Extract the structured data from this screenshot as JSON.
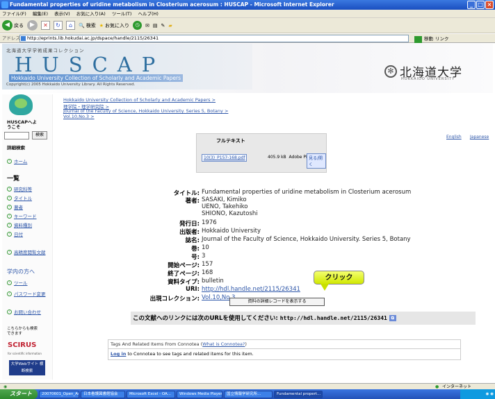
{
  "window": {
    "title": "Fundamental properties of uridine metabolism in Closterium acerosum : HUSCAP - Microsoft Internet Explorer",
    "min": "_",
    "max": "□",
    "close": "×"
  },
  "menu": [
    "ファイル(F)",
    "編集(E)",
    "表示(V)",
    "お気に入り(A)",
    "ツール(T)",
    "ヘルプ(H)"
  ],
  "toolbar": {
    "back": "戻る",
    "search": "検索",
    "favorites": "お気に入り"
  },
  "address": {
    "label": "アドレス(D)",
    "url": "http://eprints.lib.hokudai.ac.jp/dspace/handle/2115/26341",
    "go": "移動",
    "links": "リンク"
  },
  "banner": {
    "coll_jp": "北海道大学学術成果コレクション",
    "logo": "HUSCAP",
    "subtitle": "Hokkaido University Collection of Scholarly and Academic Papers",
    "copyright": "Copyright(c) 2005 Hokkaido University Library. All Rights Reserved.",
    "univ": "北海道大学",
    "univ_en": "HOKKAIDO UNIVERSITY"
  },
  "sidebar": {
    "welcome": "HUSCAPへようこそ",
    "search_btn": "検索",
    "advanced": "詳細検索",
    "home": "ホーム",
    "list_head": "一覧",
    "list": [
      "研究科等",
      "タイトル",
      "著者",
      "キーワード",
      "資料種別",
      "日付"
    ],
    "hot": "高精度閲覧文献",
    "for_you": "学内の方へ",
    "tools": [
      "ツール",
      "パスワード変更"
    ],
    "contact": "お問い合わせ",
    "more_search": "こちらからも検索できます",
    "scirus": "SCIRUS",
    "scirus_sub": "for scientific information",
    "univ_btn": "大学Webサイト 横断検索"
  },
  "breadcrumbs": [
    "Hokkaido University Collection of Scholarly and Academic Papers",
    "理学院・理学研究院",
    "Journal of the Faculty of Science, Hokkaido University. Series 5, Botany",
    "Vol.10,No.3"
  ],
  "crumb_sep": ">",
  "lang": {
    "en": "English",
    "ja": "Japanese"
  },
  "fulltext": {
    "heading": "フルテキスト",
    "file": "10(3)_P157-168.pdf",
    "size": "405.9 kB",
    "format": "Adobe PDF",
    "view": "見る/開く"
  },
  "meta": {
    "title_label": "タイトル:",
    "title": "Fundamental properties of uridine metabolism in Closterium acerosum",
    "authors_label": "著者:",
    "authors": [
      "SASAKI, Kimiko",
      "UENO, Takehiko",
      "SHIONO, Kazutoshi"
    ],
    "date_label": "発行日:",
    "date": "1976",
    "publisher_label": "出版者:",
    "publisher": "Hokkaido University",
    "journal_label": "誌名:",
    "journal": "Journal of the Faculty of Science, Hokkaido University. Series 5, Botany",
    "volume_label": "巻:",
    "volume": "10",
    "issue_label": "号:",
    "issue": "3",
    "spage_label": "開始ページ:",
    "spage": "157",
    "epage_label": "終了ページ:",
    "epage": "168",
    "type_label": "資料タイプ:",
    "type": "bulletin",
    "uri_label": "URI:",
    "uri": "http://hdl.handle.net/2115/26341",
    "coll_label": "出現コレクション:",
    "coll": "Vol.10,No.3"
  },
  "callout": "クリック",
  "full_record_btn": "資料の詳細レコードを表示する",
  "link_notice": {
    "text": "この文献へのリンクには次のURLを使用してください:",
    "url": "http://hdl.handle.net/2115/26341"
  },
  "connotea": {
    "head": "Tags And Related Items From Connotea",
    "what": "What is Connotea?",
    "login": "Log in",
    "body": "to Connotea to see tags and related items for this item."
  },
  "status": {
    "zone": "インターネット"
  },
  "taskbar": {
    "start": "スタート",
    "tasks": [
      "20070601_Open_Acce...",
      "日本看護図書館協会",
      "Microsoft Excel - OA...",
      "Windows Media Player",
      "国立情報学研究所...",
      "Fundamental propert..."
    ]
  }
}
